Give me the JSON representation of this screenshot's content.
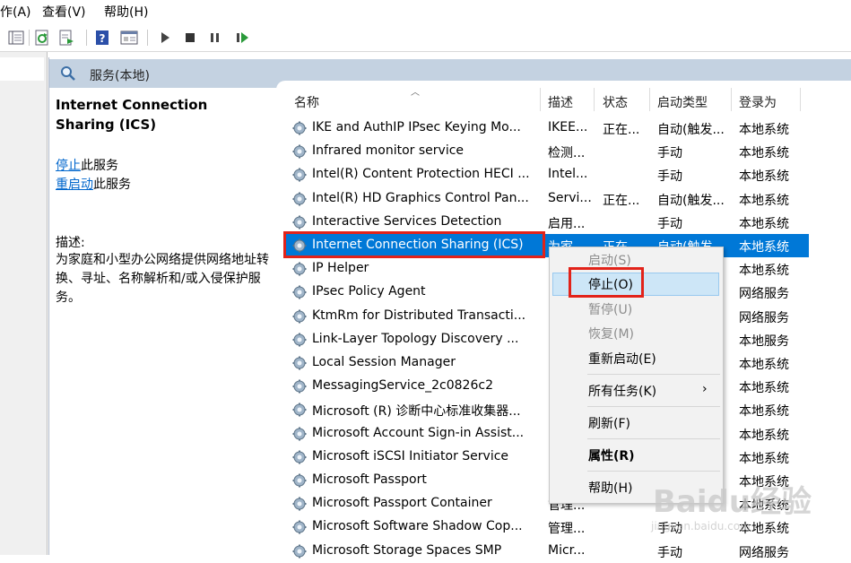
{
  "menu": [
    "作(A)",
    "查看(V)",
    "帮助(H)"
  ],
  "pane_title": "服务(本地)",
  "detail": {
    "title": "Internet Connection Sharing (ICS)",
    "stop_link": "停止",
    "stop_suffix": "此服务",
    "restart_link": "重启动",
    "restart_suffix": "此服务",
    "desc_label": "描述:",
    "desc_text": "为家庭和小型办公网络提供网络地址转换、寻址、名称解析和/或入侵保护服务。"
  },
  "columns": {
    "name": "名称",
    "desc": "描述",
    "status": "状态",
    "startup": "启动类型",
    "logon": "登录为"
  },
  "services": [
    {
      "name": "IKE and AuthIP IPsec Keying Mo...",
      "desc": "IKEE...",
      "status": "正在...",
      "startup": "自动(触发...",
      "logon": "本地系统"
    },
    {
      "name": "Infrared monitor service",
      "desc": "检测...",
      "status": "",
      "startup": "手动",
      "logon": "本地系统"
    },
    {
      "name": "Intel(R) Content Protection HECI ...",
      "desc": "Intel...",
      "status": "",
      "startup": "手动",
      "logon": "本地系统"
    },
    {
      "name": "Intel(R) HD Graphics Control Pan...",
      "desc": "Servi...",
      "status": "正在...",
      "startup": "自动(触发...",
      "logon": "本地系统"
    },
    {
      "name": "Interactive Services Detection",
      "desc": "启用...",
      "status": "",
      "startup": "手动",
      "logon": "本地系统"
    },
    {
      "name": "Internet Connection Sharing (ICS)",
      "desc": "为家...",
      "status": "正在...",
      "startup": "自动(触发...",
      "logon": "本地系统"
    },
    {
      "name": "IP Helper",
      "desc": "",
      "status": "",
      "startup": "",
      "logon": "本地系统"
    },
    {
      "name": "IPsec Policy Agent",
      "desc": "",
      "status": "",
      "startup": "",
      "logon": "网络服务"
    },
    {
      "name": "KtmRm for Distributed Transacti...",
      "desc": "",
      "status": "",
      "startup": "",
      "logon": "网络服务"
    },
    {
      "name": "Link-Layer Topology Discovery ...",
      "desc": "",
      "status": "",
      "startup": "",
      "logon": "本地服务"
    },
    {
      "name": "Local Session Manager",
      "desc": "",
      "status": "",
      "startup": "",
      "logon": "本地系统"
    },
    {
      "name": "MessagingService_2c0826c2",
      "desc": "",
      "status": "",
      "startup": "",
      "logon": "本地系统"
    },
    {
      "name": "Microsoft (R) 诊断中心标准收集器...",
      "desc": "",
      "status": "",
      "startup": "",
      "logon": "本地系统"
    },
    {
      "name": "Microsoft Account Sign-in Assist...",
      "desc": "",
      "status": "",
      "startup": "",
      "logon": "本地系统"
    },
    {
      "name": "Microsoft iSCSI Initiator Service",
      "desc": "",
      "status": "",
      "startup": "",
      "logon": "本地系统"
    },
    {
      "name": "Microsoft Passport",
      "desc": "",
      "status": "",
      "startup": "",
      "logon": "本地系统"
    },
    {
      "name": "Microsoft Passport Container",
      "desc": "管理...",
      "status": "",
      "startup": "",
      "logon": "本地系统"
    },
    {
      "name": "Microsoft Software Shadow Cop...",
      "desc": "管理...",
      "status": "",
      "startup": "手动",
      "logon": "本地系统"
    },
    {
      "name": "Microsoft Storage Spaces SMP",
      "desc": "Micr...",
      "status": "",
      "startup": "手动",
      "logon": "网络服务"
    }
  ],
  "context_menu": {
    "start": "启动(S)",
    "stop": "停止(O)",
    "pause": "暂停(U)",
    "resume": "恢复(M)",
    "restart": "重新启动(E)",
    "all_tasks": "所有任务(K)",
    "refresh": "刷新(F)",
    "properties": "属性(R)",
    "help": "帮助(H)"
  },
  "watermark": "Baidu经验",
  "watermark_url": "jingyan.baidu.com",
  "colors": {
    "selection": "#0078d7",
    "header": "#c4d2e1",
    "highlight_box": "#e2231a",
    "link": "#0066cc"
  }
}
